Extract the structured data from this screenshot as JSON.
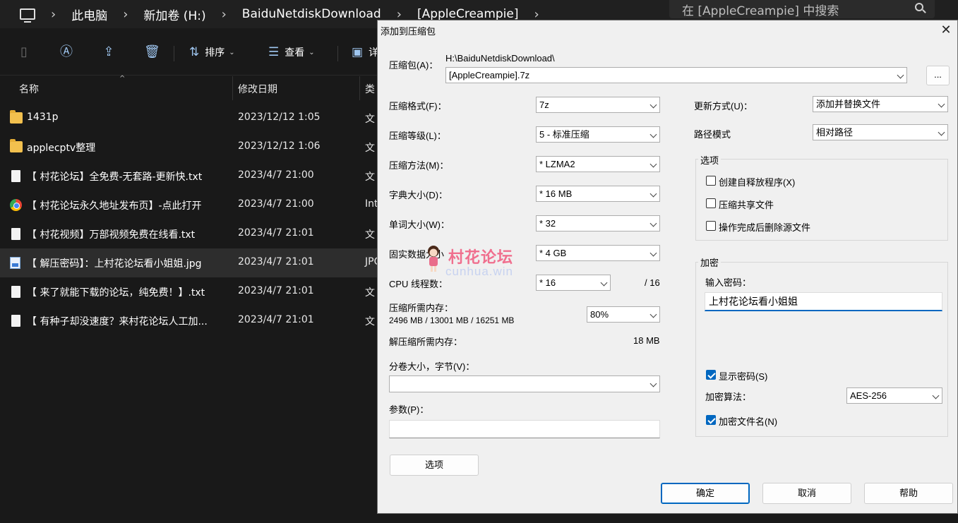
{
  "explorer": {
    "breadcrumb": [
      "此电脑",
      "新加卷 (H:)",
      "BaiduNetdiskDownload",
      "[AppleCreampie]"
    ],
    "search_placeholder": "在 [AppleCreampie] 中搜索",
    "toolbar": {
      "sort_label": "排序",
      "view_label": "查看",
      "more_label": "详"
    },
    "columns": {
      "name": "名称",
      "date": "修改日期",
      "type": "类"
    },
    "files": [
      {
        "name": "1431p",
        "date": "2023/12/12 1:05",
        "type": "文",
        "icon": "folder-icon"
      },
      {
        "name": "applecptv整理",
        "date": "2023/12/12 1:06",
        "type": "文",
        "icon": "folder-icon"
      },
      {
        "name": "【 村花论坛】全免费-无套路-更新快.txt",
        "date": "2023/4/7 21:00",
        "type": "文",
        "icon": "text-file-icon"
      },
      {
        "name": "【 村花论坛永久地址发布页】-点此打开",
        "date": "2023/4/7 21:00",
        "type": "Int",
        "icon": "chrome-icon"
      },
      {
        "name": "【 村花视频】万部视频免费在线看.txt",
        "date": "2023/4/7 21:01",
        "type": "文",
        "icon": "text-file-icon"
      },
      {
        "name": "【 解压密码】：上村花论坛看小姐姐.jpg",
        "date": "2023/4/7 21:01",
        "type": "JPG",
        "icon": "image-file-icon",
        "selected": true
      },
      {
        "name": "【 来了就能下载的论坛，纯免费！】.txt",
        "date": "2023/4/7 21:01",
        "type": "文",
        "icon": "text-file-icon"
      },
      {
        "name": "【 有种子却没速度？来村花论坛人工加...",
        "date": "2023/4/7 21:01",
        "type": "文",
        "icon": "text-file-icon"
      }
    ]
  },
  "dialog": {
    "title": "添加到压缩包",
    "archive_label": "压缩包(A)：",
    "archive_path": "H:\\BaiduNetdiskDownload\\",
    "archive_name": "[AppleCreampie].7z",
    "browse_label": "...",
    "format_label": "压缩格式(F)：",
    "format_value": "7z",
    "level_label": "压缩等级(L)：",
    "level_value": "5 - 标准压缩",
    "method_label": "压缩方法(M)：",
    "method_value": "* LZMA2",
    "dict_label": "字典大小(D)：",
    "dict_value": "* 16 MB",
    "word_label": "单词大小(W)：",
    "word_value": "* 32",
    "solid_label": "固实数据大小",
    "solid_value": "* 4 GB",
    "threads_label": "CPU 线程数：",
    "threads_value": "* 16",
    "threads_total": "/ 16",
    "mem_compress_label": "压缩所需内存：",
    "mem_compress_values": "2496 MB / 13001 MB / 16251 MB",
    "mem_percent": "80%",
    "mem_decompress_label": "解压缩所需内存：",
    "mem_decompress_value": "18 MB",
    "split_label": "分卷大小，字节(V)：",
    "split_value": "",
    "params_label": "参数(P)：",
    "params_value": "",
    "options_button": "选项",
    "update_label": "更新方式(U)：",
    "update_value": "添加并替换文件",
    "path_label": "路径模式",
    "path_value": "相对路径",
    "options_group": "选项",
    "opt_sfx": "创建自释放程序(X)",
    "opt_shared": "压缩共享文件",
    "opt_delete": "操作完成后删除源文件",
    "encrypt_group": "加密",
    "password_label": "输入密码：",
    "password_value": "上村花论坛看小姐姐",
    "show_password": "显示密码(S)",
    "enc_method_label": "加密算法：",
    "enc_method_value": "AES-256",
    "encrypt_names": "加密文件名(N)",
    "ok": "确定",
    "cancel": "取消",
    "help": "帮助"
  },
  "watermark": {
    "title": "村花论坛",
    "subtitle": "cunhua.win"
  },
  "colors": {
    "accent": "#0067c0",
    "explorer_bg": "#191919",
    "dialog_bg": "#f0f0f0",
    "watermark_pink": "#f06f8e"
  }
}
